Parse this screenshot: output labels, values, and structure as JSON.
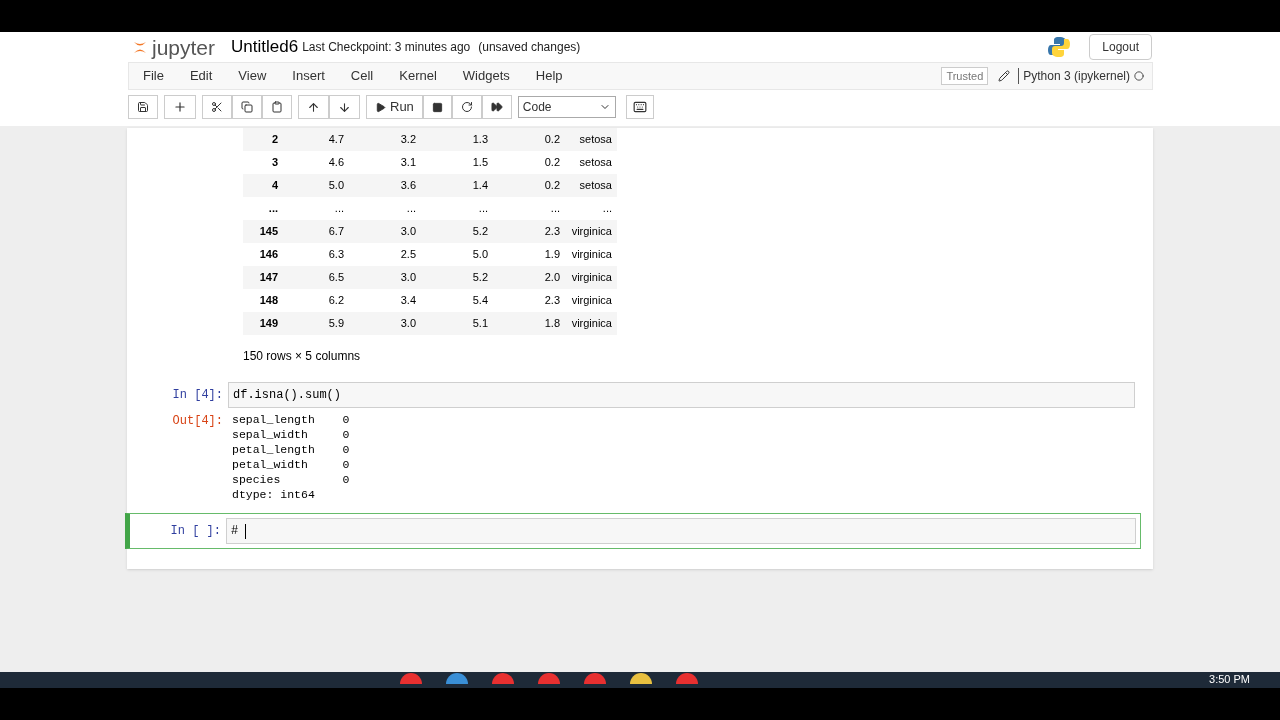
{
  "header": {
    "logo": "jupyter",
    "notebook_name": "Untitled6",
    "checkpoint": "Last Checkpoint: 3 minutes ago",
    "unsaved": "(unsaved changes)",
    "logout": "Logout"
  },
  "menu": [
    "File",
    "Edit",
    "View",
    "Insert",
    "Cell",
    "Kernel",
    "Widgets",
    "Help"
  ],
  "trusted": "Trusted",
  "kernel": "Python 3 (ipykernel)",
  "toolbar": {
    "run": "Run",
    "cell_type": "Code"
  },
  "table": {
    "rows": [
      [
        "2",
        "4.7",
        "3.2",
        "1.3",
        "0.2",
        "setosa"
      ],
      [
        "3",
        "4.6",
        "3.1",
        "1.5",
        "0.2",
        "setosa"
      ],
      [
        "4",
        "5.0",
        "3.6",
        "1.4",
        "0.2",
        "setosa"
      ],
      [
        "...",
        "...",
        "...",
        "...",
        "...",
        "..."
      ],
      [
        "145",
        "6.7",
        "3.0",
        "5.2",
        "2.3",
        "virginica"
      ],
      [
        "146",
        "6.3",
        "2.5",
        "5.0",
        "1.9",
        "virginica"
      ],
      [
        "147",
        "6.5",
        "3.0",
        "5.2",
        "2.0",
        "virginica"
      ],
      [
        "148",
        "6.2",
        "3.4",
        "5.4",
        "2.3",
        "virginica"
      ],
      [
        "149",
        "5.9",
        "3.0",
        "5.1",
        "1.8",
        "virginica"
      ]
    ],
    "shape": "150 rows × 5 columns"
  },
  "cells": [
    {
      "prompt": "In [4]:",
      "code": "df.isna().sum()",
      "selected": false,
      "out_prompt": "Out[4]:",
      "output": [
        "sepal_length    0",
        "sepal_width     0",
        "petal_length    0",
        "petal_width     0",
        "species         0",
        "dtype: int64"
      ]
    },
    {
      "prompt": "In [ ]:",
      "code": "# ",
      "selected": true
    }
  ],
  "clock": "3:50 PM"
}
